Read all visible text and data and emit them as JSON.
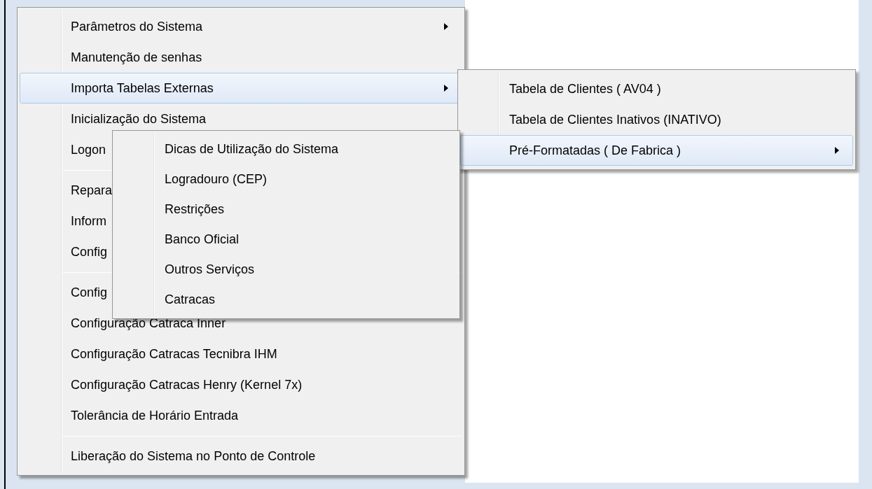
{
  "menus": [
    {
      "items": [
        {
          "kind": "item",
          "label": "Parâmetros do Sistema",
          "has_submenu": true,
          "selected": false
        },
        {
          "kind": "item",
          "label": "Manutenção de senhas",
          "has_submenu": false,
          "selected": false
        },
        {
          "kind": "item",
          "label": "Importa Tabelas Externas",
          "has_submenu": true,
          "selected": true
        },
        {
          "kind": "item",
          "label": "Inicialização do Sistema",
          "has_submenu": false,
          "selected": false
        },
        {
          "kind": "item",
          "label": "Logon",
          "has_submenu": false,
          "selected": false
        },
        {
          "kind": "separator"
        },
        {
          "kind": "item",
          "label": "Repara",
          "has_submenu": false,
          "selected": false
        },
        {
          "kind": "item",
          "label": "Inform",
          "has_submenu": false,
          "selected": false
        },
        {
          "kind": "item",
          "label": "Config",
          "has_submenu": false,
          "selected": false
        },
        {
          "kind": "separator"
        },
        {
          "kind": "item",
          "label": "Config",
          "has_submenu": false,
          "selected": false
        },
        {
          "kind": "item",
          "label": "Configuração Catraca Inner",
          "has_submenu": false,
          "selected": false
        },
        {
          "kind": "item",
          "label": "Configuração Catracas Tecnibra IHM",
          "has_submenu": false,
          "selected": false
        },
        {
          "kind": "item",
          "label": "Configuração Catracas Henry (Kernel 7x)",
          "has_submenu": false,
          "selected": false
        },
        {
          "kind": "item",
          "label": "Tolerância de Horário Entrada",
          "has_submenu": false,
          "selected": false
        },
        {
          "kind": "separator"
        },
        {
          "kind": "item",
          "label": "Liberação do Sistema no Ponto de Controle",
          "has_submenu": false,
          "selected": false
        }
      ]
    },
    {
      "items": [
        {
          "kind": "item",
          "label": "Tabela de Clientes ( AV04 )",
          "has_submenu": false,
          "selected": false
        },
        {
          "kind": "item",
          "label": "Tabela de Clientes Inativos (INATIVO)",
          "has_submenu": false,
          "selected": false
        },
        {
          "kind": "item",
          "label": "Pré-Formatadas ( De Fabrica )",
          "has_submenu": true,
          "selected": true
        }
      ]
    },
    {
      "items": [
        {
          "kind": "item",
          "label": "Dicas de Utilização do Sistema",
          "has_submenu": false,
          "selected": false
        },
        {
          "kind": "item",
          "label": "Logradouro (CEP)",
          "has_submenu": false,
          "selected": false
        },
        {
          "kind": "item",
          "label": "Restrições",
          "has_submenu": false,
          "selected": false
        },
        {
          "kind": "item",
          "label": "Banco Oficial",
          "has_submenu": false,
          "selected": false
        },
        {
          "kind": "item",
          "label": "Outros Serviços",
          "has_submenu": false,
          "selected": false
        },
        {
          "kind": "item",
          "label": "Catracas",
          "has_submenu": false,
          "selected": false
        }
      ]
    }
  ]
}
